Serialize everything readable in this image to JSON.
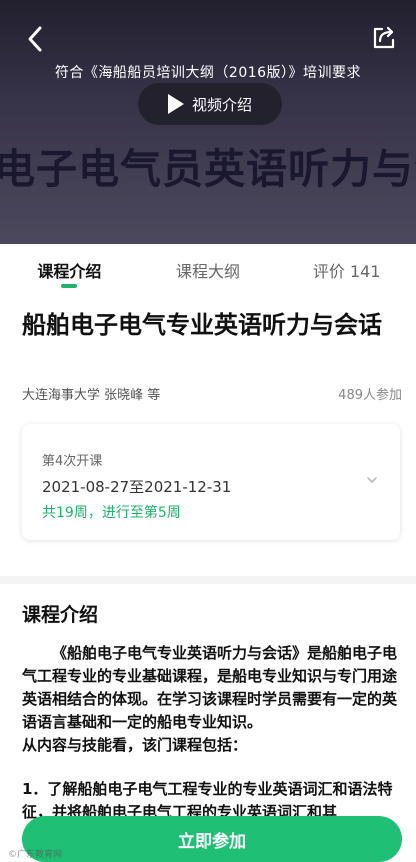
{
  "banner": {
    "subtitle": "符合《海船船员培训大纲（2016版）》培训要求",
    "video_label": "视频介绍",
    "title": "电子电气员英语听力与会话"
  },
  "tabs": [
    {
      "label": "课程介绍",
      "active": true
    },
    {
      "label": "课程大纲",
      "active": false
    },
    {
      "label": "评价 141",
      "active": false
    }
  ],
  "course": {
    "title": "船舶电子电气专业英语听力与会话",
    "author": "大连海事大学 张晓峰 等",
    "participants": "489人参加"
  },
  "session": {
    "label": "第4次开课",
    "dates": "2021-08-27至2021-12-31",
    "progress": "共19周，进行至第5周"
  },
  "intro": {
    "heading": "课程介绍",
    "para1": "《船舶电子电气专业英语听力与会话》是船舶电子电气工程专业的专业基础课程，是船电专业知识与专门用途英语相结合的体现。在学习该课程时学员需要有一定的英语语言基础和一定的船电专业知识。",
    "para2": "从内容与技能看，该门课程包括：",
    "point1": "1．了解船舶电子电气工程专业的专业英语词汇和语法特征，并将船舶电子电气工程的专业英语词汇和其"
  },
  "actions": {
    "join_label": "立即参加"
  },
  "watermark": "©广东教育网",
  "colors": {
    "accent": "#1fb36b",
    "join_button": "#1fc076"
  },
  "icons": {
    "back": "chevron-left-icon",
    "share": "share-icon",
    "play": "play-icon",
    "expand": "chevron-down-icon"
  }
}
